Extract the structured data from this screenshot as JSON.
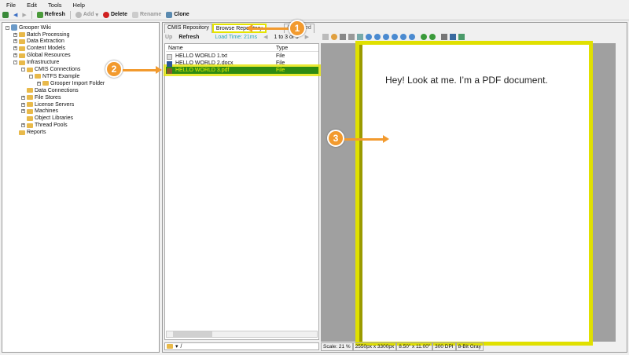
{
  "menu": [
    "File",
    "Edit",
    "Tools",
    "Help"
  ],
  "toolbar": {
    "refresh": "Refresh",
    "add": "Add",
    "delete": "Delete",
    "rename": "Rename",
    "clone": "Clone"
  },
  "tree": {
    "root": "Grooper Wiki",
    "items": [
      {
        "label": "Batch Processing",
        "level": 1,
        "exp": "+"
      },
      {
        "label": "Data Extraction",
        "level": 1,
        "exp": "+"
      },
      {
        "label": "Content Models",
        "level": 1,
        "exp": "+"
      },
      {
        "label": "Global Resources",
        "level": 1,
        "exp": "+"
      },
      {
        "label": "Infrastructure",
        "level": 1,
        "exp": "-"
      },
      {
        "label": "CMIS Connections",
        "level": 2,
        "exp": "-"
      },
      {
        "label": "NTFS Example",
        "level": 3,
        "exp": "-"
      },
      {
        "label": "Grooper Import Folder",
        "level": 4,
        "exp": "+"
      },
      {
        "label": "Data Connections",
        "level": 2,
        "exp": ""
      },
      {
        "label": "File Stores",
        "level": 2,
        "exp": "+"
      },
      {
        "label": "License Servers",
        "level": 2,
        "exp": "+"
      },
      {
        "label": "Machines",
        "level": 2,
        "exp": "+"
      },
      {
        "label": "Object Libraries",
        "level": 2,
        "exp": ""
      },
      {
        "label": "Thread Pools",
        "level": 2,
        "exp": "+"
      },
      {
        "label": "Reports",
        "level": 1,
        "exp": ""
      }
    ]
  },
  "tabs": {
    "cmis": "CMIS Repository",
    "browse": "Browse Repository",
    "advanced": "Advanced"
  },
  "browser": {
    "up": "Up",
    "refresh": "Refresh",
    "load_time": "Load Time: 21ms",
    "paging": "1 to 3 of 3",
    "columns": [
      "Name",
      "Type"
    ],
    "rows": [
      {
        "name": "HELLO WORLD 1.txt",
        "type": "File"
      },
      {
        "name": "HELLO WORLD 2.docx",
        "type": "File"
      },
      {
        "name": "HELLO WORLD 3.pdf",
        "type": "File"
      }
    ],
    "path": "/"
  },
  "viewer": {
    "text": "Hey!  Look at me.  I’m a PDF document.",
    "status": [
      "Scale: 21 %",
      "2550px x 3300px",
      "8.50\" x 11.00\"",
      "300 DPI",
      "8-Bit Gray"
    ]
  },
  "callouts": [
    "1",
    "2",
    "3"
  ],
  "colors": {
    "highlight": "#e4e400",
    "callout": "#f29a2e",
    "selected": "#2e8b12"
  }
}
